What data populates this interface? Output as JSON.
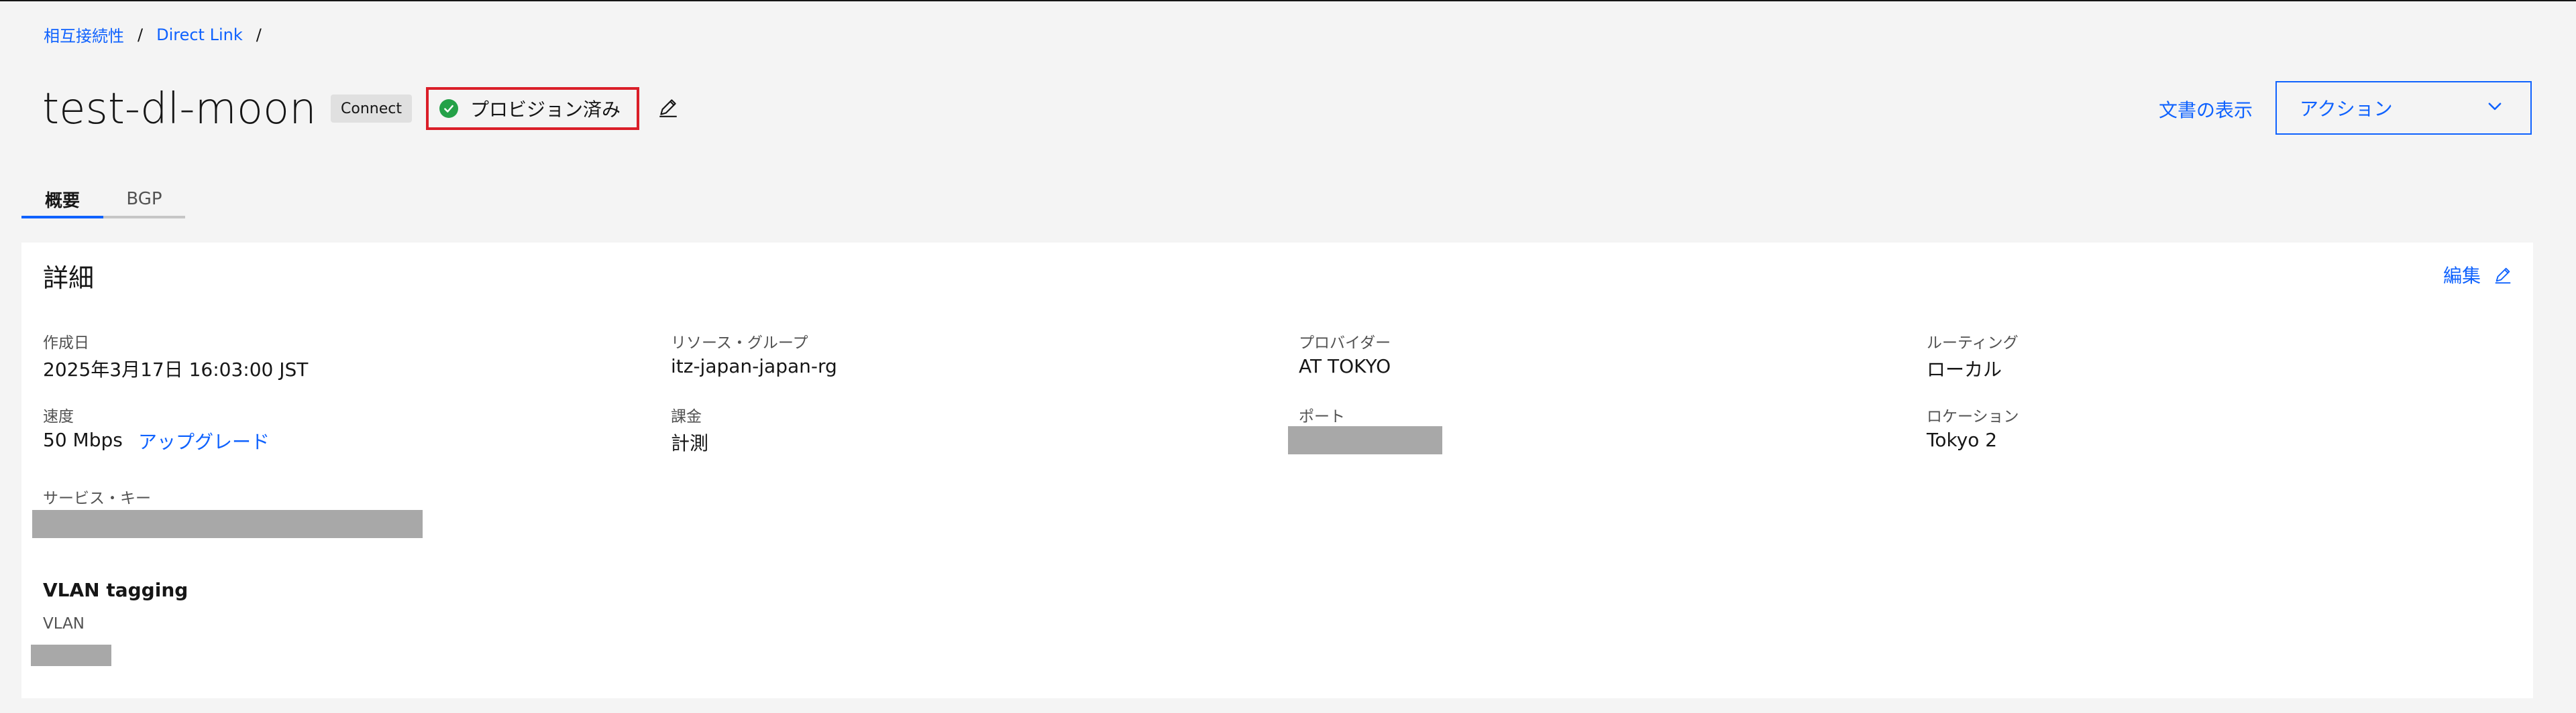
{
  "breadcrumb": {
    "items": [
      "相互接続性",
      "Direct Link"
    ],
    "separator": "/"
  },
  "header": {
    "title": "test-dl-moon",
    "type_tag": "Connect",
    "status": "プロビジョン済み",
    "docs_link": "文書の表示",
    "actions_label": "アクション"
  },
  "icons": {
    "status": "checkmark-filled-icon",
    "edit": "pencil-edit-icon",
    "dropdown": "chevron-down-icon"
  },
  "colors": {
    "accent": "#0f62fe",
    "status_success": "#24a148",
    "highlight_border": "#da1e28",
    "redaction": "#a8a8a8"
  },
  "tabs": [
    {
      "label": "概要",
      "active": true
    },
    {
      "label": "BGP",
      "active": false
    }
  ],
  "details": {
    "title": "詳細",
    "edit_label": "編集",
    "fields": {
      "created": {
        "label": "作成日",
        "value": "2025年3月17日 16:03:00 JST"
      },
      "resource_group": {
        "label": "リソース・グループ",
        "value": "itz-japan-japan-rg"
      },
      "provider": {
        "label": "プロバイダー",
        "value": "AT TOKYO"
      },
      "routing": {
        "label": "ルーティング",
        "value": "ローカル"
      },
      "speed": {
        "label": "速度",
        "value": "50 Mbps",
        "action": "アップグレード"
      },
      "billing": {
        "label": "課金",
        "value": "計測"
      },
      "port": {
        "label": "ポート"
      },
      "location": {
        "label": "ロケーション",
        "value": "Tokyo 2"
      },
      "service_key": {
        "label": "サービス・キー"
      }
    },
    "vlan": {
      "heading": "VLAN tagging",
      "label": "VLAN"
    }
  }
}
